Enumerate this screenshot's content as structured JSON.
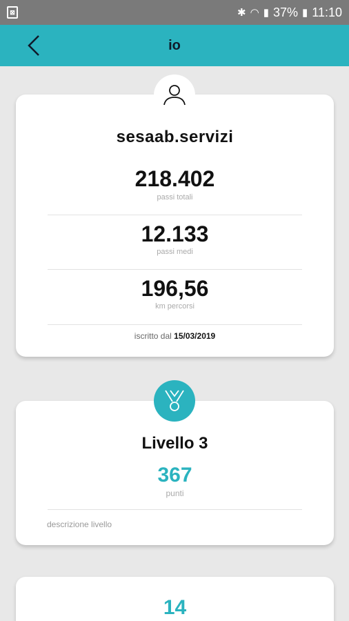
{
  "status_bar": {
    "battery": "37%",
    "time": "11:10",
    "icons": [
      "notification-icon",
      "bluetooth-icon",
      "wifi-icon",
      "signal-icon",
      "battery-icon"
    ]
  },
  "app_bar": {
    "title": "io",
    "back_icon": "chevron-left-icon",
    "color": "#2bb3bf"
  },
  "profile": {
    "avatar_icon": "user-icon",
    "username": "sesaab.servizi",
    "stats": [
      {
        "value": "218.402",
        "label": "passi totali"
      },
      {
        "value": "12.133",
        "label": "passi medi"
      },
      {
        "value": "196,56",
        "label": "km percorsi"
      }
    ],
    "joined_label": "iscritto dal",
    "joined_date": "15/03/2019"
  },
  "level": {
    "icon": "medal-icon",
    "title": "Livello 3",
    "points": "367",
    "points_label": "punti",
    "description": "descrizione livello"
  },
  "third_card": {
    "value": "14"
  }
}
